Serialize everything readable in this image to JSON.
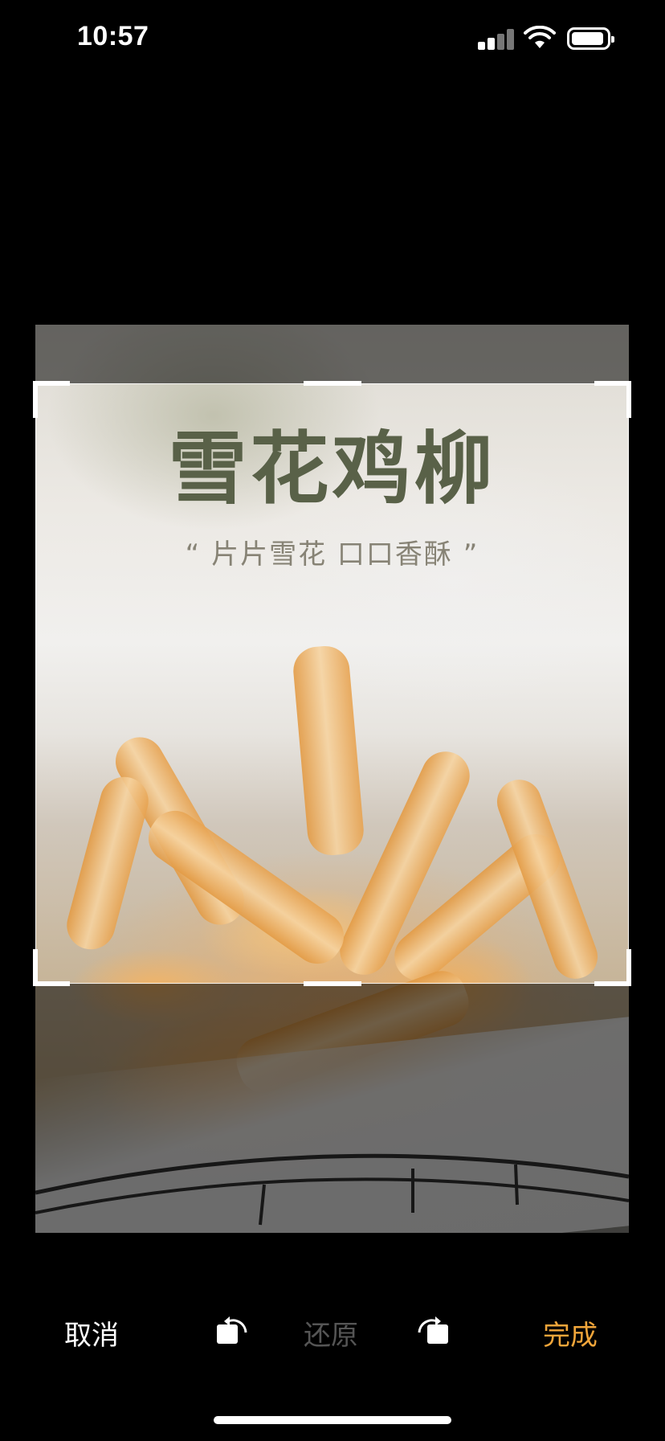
{
  "status_bar": {
    "time": "10:57"
  },
  "image": {
    "title": "雪花鸡柳",
    "subtitle": "“ 片片雪花  口口香酥 ”"
  },
  "toolbar": {
    "cancel_label": "取消",
    "reset_label": "还原",
    "done_label": "完成"
  },
  "colors": {
    "accent": "#f0a53a",
    "background": "#000000",
    "title_color": "#596148"
  },
  "icons": [
    "signal-icon",
    "wifi-icon",
    "battery-icon",
    "rotate-left-icon",
    "rotate-right-icon"
  ]
}
